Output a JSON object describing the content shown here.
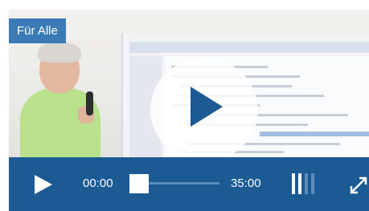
{
  "badge": {
    "label": "Für Alle"
  },
  "player": {
    "current_time": "00:00",
    "duration": "35:00",
    "progress": 0,
    "quality_bars": {
      "total": 4,
      "active": 2
    }
  },
  "icons": {
    "big_play": "play-icon",
    "control_play": "play-icon",
    "quality": "signal-bars-icon",
    "fullscreen": "expand-icon"
  },
  "colors": {
    "control_bar": "#1c5a93",
    "badge": "#3a7bb5",
    "play_triangle": "#1c5a93",
    "track": "#5d8cbf",
    "foreground": "#ffffff"
  }
}
